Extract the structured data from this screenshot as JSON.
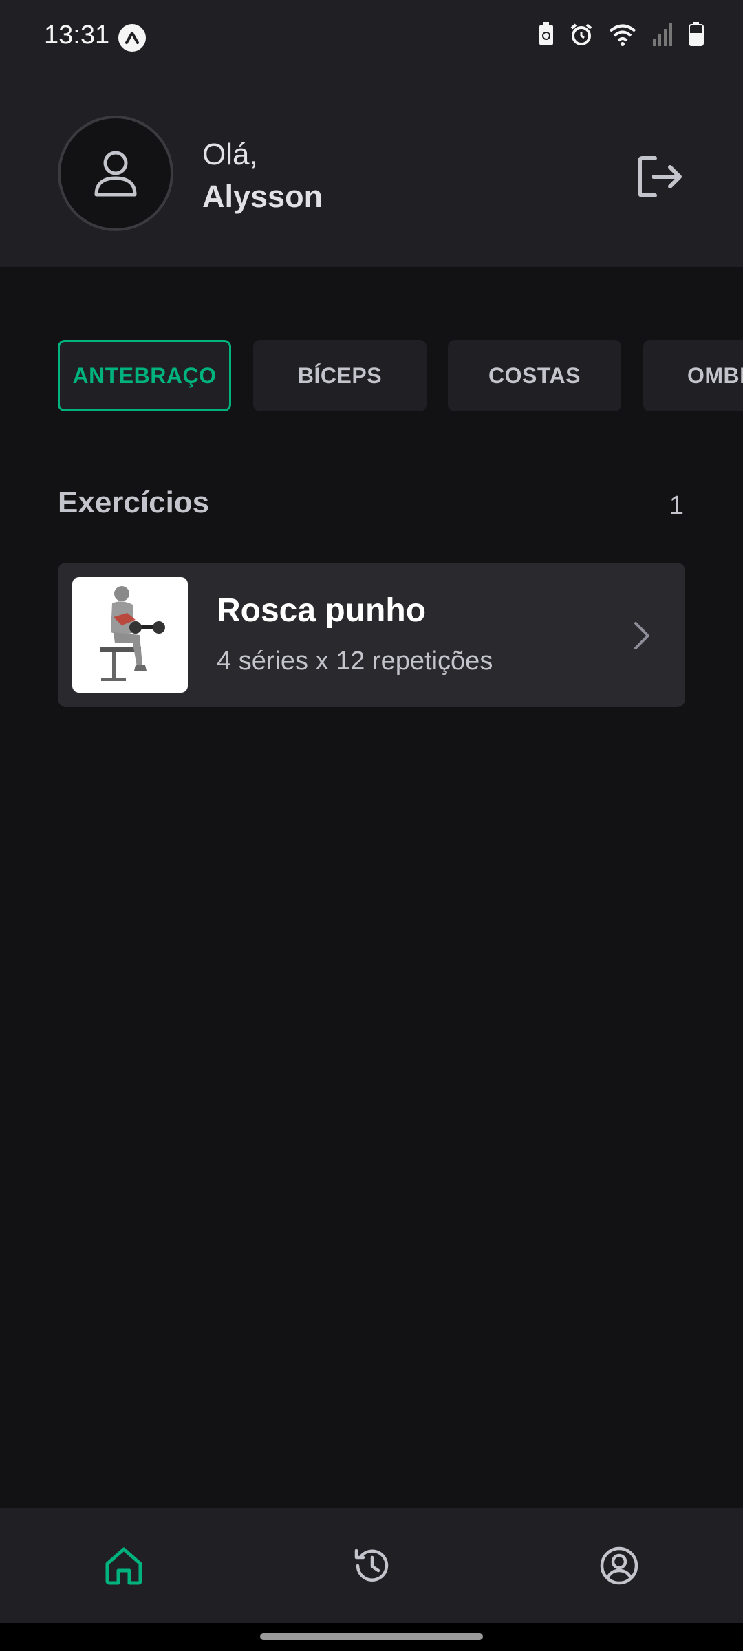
{
  "status_bar": {
    "time": "13:31",
    "icons": [
      "app-notification-icon",
      "battery-saver-icon",
      "alarm-icon",
      "wifi-icon",
      "signal-icon",
      "battery-icon"
    ]
  },
  "header": {
    "greeting": "Olá,",
    "user_name": "Alysson",
    "avatar_icon": "user-icon",
    "logout_icon": "sign-out-icon"
  },
  "tabs": [
    {
      "label": "ANTEBRAÇO",
      "active": true
    },
    {
      "label": "BÍCEPS",
      "active": false
    },
    {
      "label": "COSTAS",
      "active": false
    },
    {
      "label": "OMBROS",
      "active": false
    }
  ],
  "exercises_section": {
    "title": "Exercícios",
    "count": "1"
  },
  "exercises": [
    {
      "name": "Rosca punho",
      "info": "4 séries x 12 repetições",
      "chevron_icon": "chevron-right-icon"
    }
  ],
  "bottom_nav": [
    {
      "icon": "home-icon",
      "active": true
    },
    {
      "icon": "history-icon",
      "active": false
    },
    {
      "icon": "profile-icon",
      "active": false
    }
  ],
  "colors": {
    "background": "#121214",
    "surface": "#202024",
    "card": "#29292E",
    "accent": "#00B37E",
    "text_primary": "#E1E1E6",
    "text_secondary": "#C4C4CC"
  }
}
